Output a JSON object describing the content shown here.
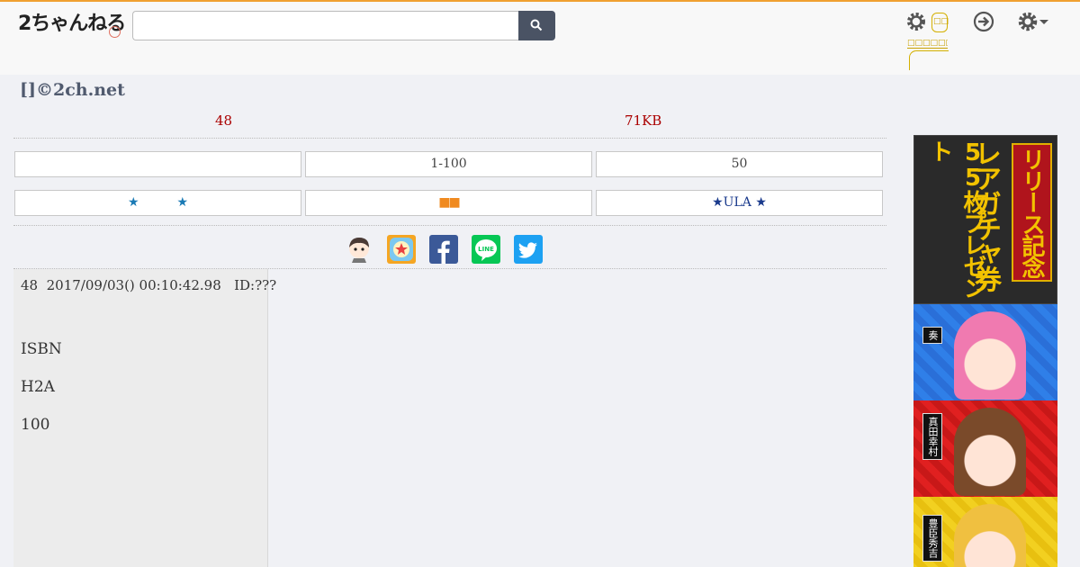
{
  "site": {
    "logo_text": "2ちゃんねる"
  },
  "header": {
    "search_placeholder": "",
    "yellow_label": "□□□□□□□",
    "yellow_box_label": "□□"
  },
  "thread": {
    "title": "[]©2ch.net",
    "post_count": "48",
    "size": "71KB"
  },
  "nav": {
    "row1": [
      "",
      "1-100",
      "50"
    ],
    "row2": [
      "★　　　★",
      "■■",
      "★ULA ★"
    ]
  },
  "share_icons": [
    "character-icon",
    "app-icon",
    "facebook-icon",
    "line-icon",
    "twitter-icon"
  ],
  "post": {
    "header": "48  2017/09/03() 00:10:42.98   ID:???",
    "lines": [
      "ISBN",
      "H2A",
      "100"
    ]
  },
  "ad": {
    "text1": "リリース記念",
    "text2": "レアガチャ券",
    "text3": "55枚プレゼント",
    "labels": [
      "奏",
      "真田幸村",
      "豊臣秀吉"
    ]
  },
  "colors": {
    "accent_top": "#f0a030",
    "meta_red": "#aa0000",
    "title": "#505a6e",
    "star_blue": "#1a7ab5",
    "orange": "#f08a20"
  }
}
